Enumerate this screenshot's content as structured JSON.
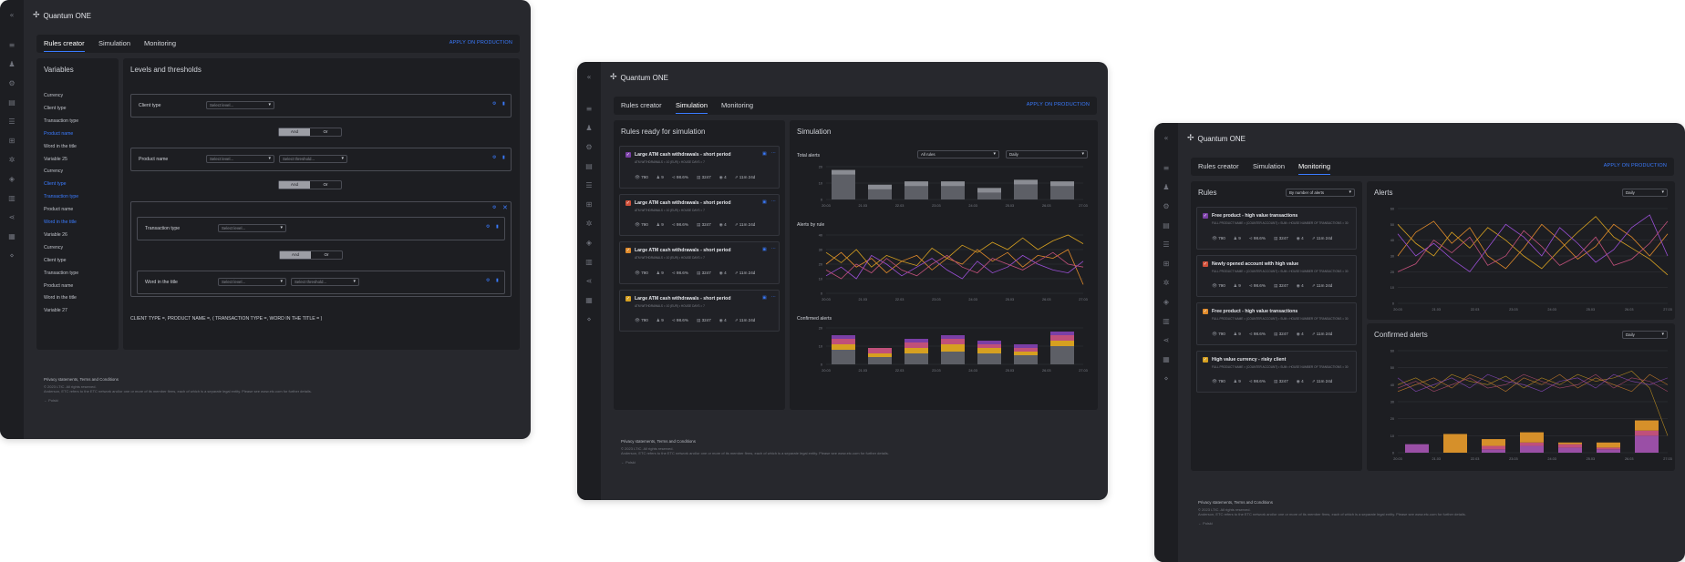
{
  "app": {
    "logo": "Quantum ONE"
  },
  "tabs": [
    "Rules creator",
    "Simulation",
    "Monitoring"
  ],
  "apply_label": "APPLY ON PRODUCTION",
  "screen1": {
    "variables_title": "Variables",
    "variables": [
      "Currency",
      "Client type",
      "Transaction type",
      "Product name",
      "Word in the title",
      "Variable 25",
      "Currency",
      "Client type",
      "Transaction type",
      "Product name",
      "Word in the title",
      "Variable 26",
      "Currency",
      "Client type",
      "Transaction type",
      "Product name",
      "Word in the title",
      "Variable 27"
    ],
    "variables_highlight": [
      3,
      7,
      8,
      10
    ],
    "levels_title": "Levels and thresholds",
    "select_level": "Select level...",
    "select_threshold": "Select threshold...",
    "and_label": "And",
    "or_label": "Or",
    "conditions": [
      "Client type",
      "Product name",
      "Transaction type",
      "Word in the title"
    ],
    "formula": "CLIENT TYPE =, PRODUCT NAME =, ( TRANSACTION TYPE =, WORD IN THE TITLE = )"
  },
  "footer": {
    "links": "Privacy statements, Terms and Conditions",
    "copyright": "© 2023 LTIC. All rights reserved.",
    "disclaimer": "Anderson, ETC refers to the ETC network and/or one or more of its member firms, each of which is a separate legal entity. Please see www.etc.com for further details.",
    "lang": "← Polski"
  },
  "screen2": {
    "rules_title": "Rules ready for simulation",
    "rules": [
      {
        "title": "Large ATM cash withdrawals - short period",
        "color": "#7a3fa6"
      },
      {
        "title": "Large ATM cash withdrawals - short period",
        "color": "#d0503a"
      },
      {
        "title": "Large ATM cash withdrawals - short period",
        "color": "#e08a2a"
      },
      {
        "title": "Large ATM cash withdrawals - short period",
        "color": "#d6a020"
      }
    ],
    "rule_sub": "ATM WITHDRAWALS = 10 (EUR) • HOUSE DAYS = 7",
    "stats": [
      "790",
      "9",
      "98.6%",
      "3247",
      "4",
      "11m 24d"
    ],
    "sim_title": "Simulation",
    "total_alerts": "Total alerts",
    "dd_all_rules": "All rules",
    "dd_daily": "Daily",
    "alerts_by_rule": "Alerts by rule",
    "confirmed_alerts": "Confirmed alerts",
    "x_ticks": [
      "20.03",
      "21.03",
      "22.03",
      "23.03",
      "24.03",
      "25.03",
      "26.03",
      "27.03"
    ],
    "total_y": [
      "20",
      "10",
      "0"
    ],
    "rule_y": [
      "40",
      "30",
      "20",
      "10",
      "0"
    ],
    "conf_y": [
      "20",
      "10",
      "0"
    ]
  },
  "screen3": {
    "rules_title": "Rules",
    "dd_by_alerts": "By number of alerts",
    "rules": [
      {
        "title": "Free product - high value transactions",
        "color": "#7a3fa6"
      },
      {
        "title": "Newly opened account with high value",
        "color": "#d0503a"
      },
      {
        "title": "Free product - high value transactions",
        "color": "#e08a2a"
      },
      {
        "title": "High value currency - risky client",
        "color": "#d6a020"
      }
    ],
    "rule_sub": "FULL PRODUCT NAME = (COUNTER ACCOUNT) • SUM • HOUSE NUMBER OF TRANSACTIONS = 30",
    "stats": [
      "790",
      "9",
      "98.6%",
      "3247",
      "4",
      "11m 24d"
    ],
    "alerts_title": "Alerts",
    "confirmed_title": "Confirmed alerts",
    "dd_daily": "Daily",
    "x_ticks": [
      "20.03",
      "21.03",
      "22.03",
      "23.03",
      "24.03",
      "25.03",
      "26.03",
      "27.03"
    ],
    "y_ticks": [
      "60",
      "50",
      "40",
      "30",
      "20",
      "10",
      "0"
    ]
  },
  "colors": {
    "accent": "#3a7bff",
    "bg": "#27282d",
    "panel": "#1d1e22"
  }
}
